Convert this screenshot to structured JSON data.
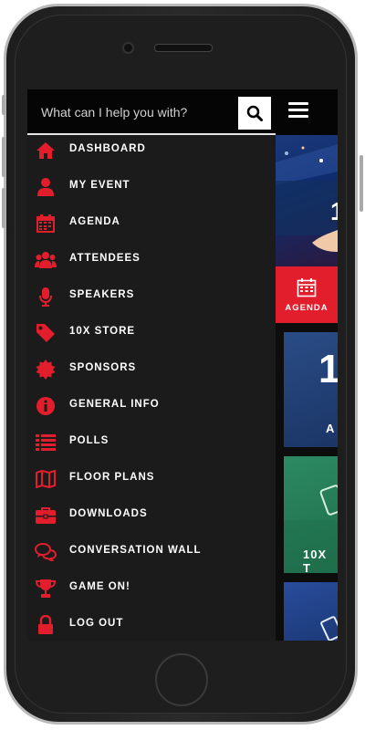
{
  "search": {
    "placeholder": "What can I help you with?"
  },
  "menu": {
    "items": [
      {
        "label": "DASHBOARD",
        "icon": "home-icon"
      },
      {
        "label": "MY EVENT",
        "icon": "user-icon"
      },
      {
        "label": "AGENDA",
        "icon": "calendar-icon"
      },
      {
        "label": "ATTENDEES",
        "icon": "users-icon"
      },
      {
        "label": "SPEAKERS",
        "icon": "microphone-icon"
      },
      {
        "label": "10X STORE",
        "icon": "tag-icon"
      },
      {
        "label": "SPONSORS",
        "icon": "badge-icon"
      },
      {
        "label": "GENERAL INFO",
        "icon": "info-icon"
      },
      {
        "label": "POLLS",
        "icon": "list-icon"
      },
      {
        "label": "FLOOR PLANS",
        "icon": "map-icon"
      },
      {
        "label": "DOWNLOADS",
        "icon": "briefcase-icon"
      },
      {
        "label": "CONVERSATION WALL",
        "icon": "chat-icon"
      },
      {
        "label": "GAME ON!",
        "icon": "trophy-icon"
      },
      {
        "label": "LOG OUT",
        "icon": "lock-icon"
      }
    ]
  },
  "content": {
    "hero_text": "1",
    "agenda_tile_label": "AGENDA",
    "tile1_big": "1",
    "tile1_text": "A",
    "tile2_text": "10X T"
  },
  "colors": {
    "accent": "#e21e2d",
    "header": "#050505",
    "drawer": "#1b1b1b"
  }
}
